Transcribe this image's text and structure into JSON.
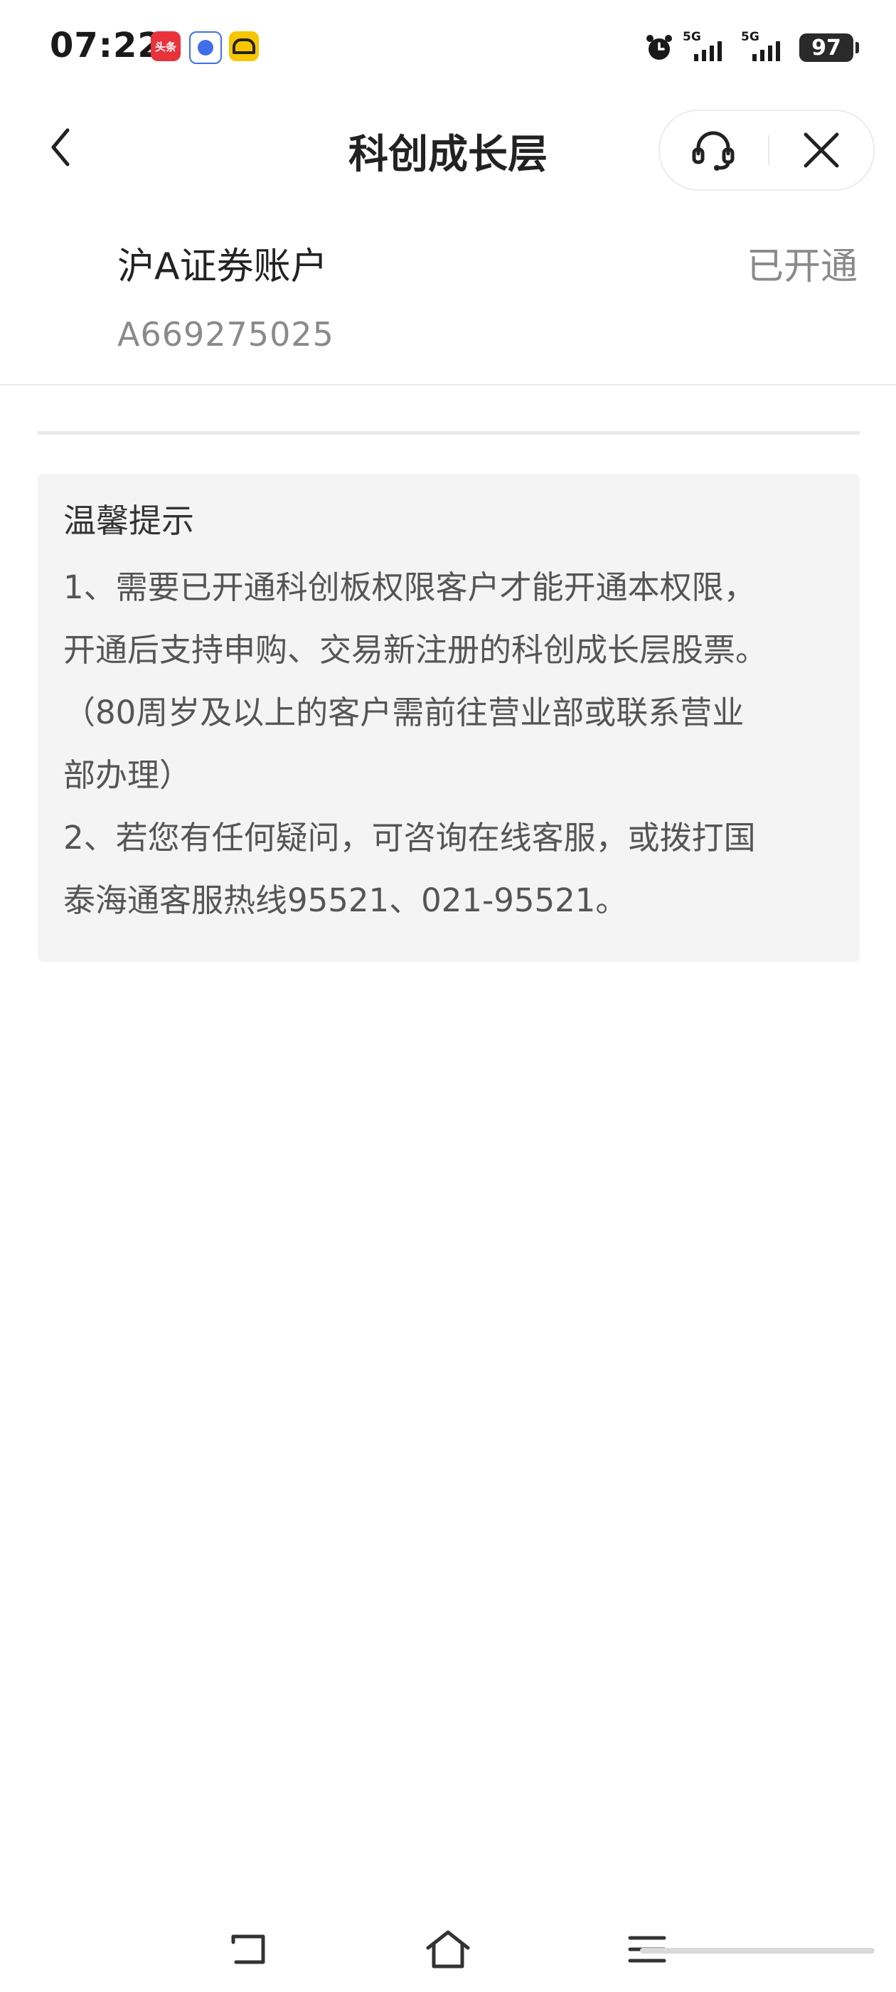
{
  "status_bar": {
    "time": "07:22",
    "app_badge_toutiao": "头条",
    "network_1": "5G",
    "network_2": "5G",
    "battery": "97"
  },
  "navbar": {
    "title": "科创成长层",
    "back_icon": "chevron-left-icon",
    "service_icon": "headset-icon",
    "close_icon": "close-icon"
  },
  "account": {
    "name": "沪A证券账户",
    "status": "已开通",
    "number": "A669275025"
  },
  "tips": {
    "title": "温馨提示",
    "lines": [
      "1、需要已开通科创板权限客户才能开通本权限，",
      "开通后支持申购、交易新注册的科创成长层股票。",
      "（80周岁及以上的客户需前往营业部或联系营业",
      "部办理）",
      "2、若您有任何疑问，可咨询在线客服，或拨打国",
      "泰海通客服热线95521、021-95521。"
    ]
  },
  "colors": {
    "text_primary": "#222222",
    "text_secondary": "#8a8a8a",
    "tips_background": "#f4f4f4",
    "divider": "#e9e9e9"
  }
}
